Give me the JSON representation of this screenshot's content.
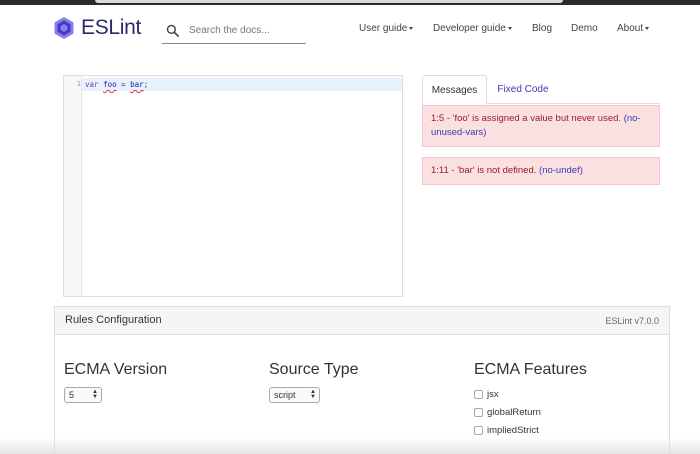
{
  "header": {
    "logo_text": "ESLint",
    "search_placeholder": "Search the docs...",
    "nav": [
      {
        "label": "User guide",
        "dropdown": true
      },
      {
        "label": "Developer guide",
        "dropdown": true
      },
      {
        "label": "Blog",
        "dropdown": false
      },
      {
        "label": "Demo",
        "dropdown": false
      },
      {
        "label": "About",
        "dropdown": true
      }
    ]
  },
  "editor": {
    "line_number": "1",
    "code": {
      "kw": "var",
      "ident": "foo",
      "op": "=",
      "value": "bar",
      "end": ";"
    }
  },
  "tabs": {
    "messages": "Messages",
    "fixed_code": "Fixed Code"
  },
  "messages": [
    {
      "text": "1:5 - 'foo' is assigned a value but never used.",
      "rule": "(no-unused-vars)"
    },
    {
      "text": "1:11 - 'bar' is not defined.",
      "rule": "(no-undef)"
    }
  ],
  "rules": {
    "title": "Rules Configuration",
    "version": "ESLint v7.0.0",
    "ecma_version_label": "ECMA Version",
    "ecma_version_value": "5",
    "source_type_label": "Source Type",
    "source_type_value": "script",
    "ecma_features_label": "ECMA Features",
    "features": [
      "jsx",
      "globalReturn",
      "impliedStrict"
    ]
  },
  "colors": {
    "brand": "#4b32c3",
    "link": "#3a3ab0",
    "error_bg": "#fbe0e1",
    "error_text": "#9b1c2a"
  }
}
